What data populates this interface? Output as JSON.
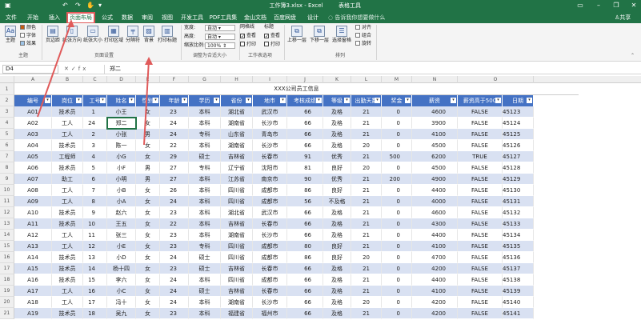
{
  "titlebar": {
    "doc_title": "工作簿3.xlsx - Excel",
    "context_title": "表格工具",
    "quick_access": [
      "save-icon",
      "undo-icon",
      "redo-icon",
      "touch-mode-icon",
      "customize-icon"
    ],
    "window_controls": [
      "ribbon-display-icon",
      "minimize-icon",
      "restore-icon",
      "close-icon"
    ]
  },
  "tabs": [
    "文件",
    "开始",
    "插入",
    "页面布局",
    "公式",
    "数据",
    "审阅",
    "视图",
    "开发工具",
    "PDF工具集",
    "金山文档",
    "百度网盘",
    "设计"
  ],
  "active_tab": "页面布局",
  "tellme": "告诉我你想要做什么",
  "share": "共享",
  "ribbon": {
    "theme_group": {
      "label": "主题",
      "main": "主题",
      "small": [
        "颜色",
        "字体",
        "效果"
      ]
    },
    "page_setup_group": {
      "label": "页面设置",
      "buttons": [
        "页边距",
        "纸张方向",
        "纸张大小",
        "打印区域",
        "分隔符",
        "背景",
        "打印标题"
      ]
    },
    "scale_group": {
      "label": "调整为合适大小",
      "rows": [
        {
          "name": "宽度:",
          "value": "自动"
        },
        {
          "name": "高度:",
          "value": "自动"
        },
        {
          "name": "缩放比例:",
          "value": "100%"
        }
      ]
    },
    "sheet_options_group": {
      "label": "工作表选项",
      "cols": [
        "网格线",
        "标题"
      ],
      "view": "查看",
      "print": "打印"
    },
    "arrange_group": {
      "label": "排列",
      "buttons": [
        "上移一层",
        "下移一层",
        "选择窗格"
      ],
      "small": [
        "对齐",
        "组合",
        "旋转"
      ]
    }
  },
  "formula_bar": {
    "name_box": "D4",
    "fx": "fx",
    "value": "郑二"
  },
  "columns": [
    "A",
    "B",
    "C",
    "D",
    "E",
    "F",
    "G",
    "H",
    "I",
    "J",
    "K",
    "L",
    "M",
    "N",
    "O"
  ],
  "table_title": "XXX公司员工信息",
  "headers": [
    "编号",
    "岗位",
    "工号",
    "姓名",
    "性别",
    "年龄",
    "学历",
    "省份",
    "地市",
    "考核成绩",
    "等级",
    "出勤天数",
    "奖金",
    "薪资",
    "薪资高于500",
    "日期"
  ],
  "rows": [
    [
      "A01",
      "技术员",
      "1",
      "小王",
      "女",
      "23",
      "本科",
      "湖北省",
      "武汉市",
      "66",
      "及格",
      "21",
      "0",
      "4600",
      "FALSE",
      "45123"
    ],
    [
      "A02",
      "工人",
      "24",
      "郑二",
      "女",
      "24",
      "本科",
      "湖南省",
      "长沙市",
      "66",
      "及格",
      "21",
      "0",
      "3900",
      "FALSE",
      "45124"
    ],
    [
      "A03",
      "工人",
      "2",
      "小张",
      "男",
      "24",
      "专科",
      "山东省",
      "青岛市",
      "66",
      "及格",
      "21",
      "0",
      "4100",
      "FALSE",
      "45125"
    ],
    [
      "A04",
      "技术员",
      "3",
      "陈一",
      "女",
      "22",
      "本科",
      "湖南省",
      "长沙市",
      "66",
      "及格",
      "20",
      "0",
      "4500",
      "FALSE",
      "45126"
    ],
    [
      "A05",
      "工程师",
      "4",
      "小G",
      "女",
      "29",
      "硕士",
      "吉林省",
      "长春市",
      "91",
      "优秀",
      "21",
      "500",
      "6200",
      "TRUE",
      "45127"
    ],
    [
      "A06",
      "技术员",
      "5",
      "小F",
      "男",
      "27",
      "专科",
      "辽宁省",
      "沈阳市",
      "81",
      "良好",
      "20",
      "0",
      "4500",
      "FALSE",
      "45128"
    ],
    [
      "A07",
      "助工",
      "6",
      "小明",
      "男",
      "27",
      "本科",
      "江苏省",
      "南京市",
      "90",
      "优秀",
      "21",
      "200",
      "4900",
      "FALSE",
      "45129"
    ],
    [
      "A08",
      "工人",
      "7",
      "小B",
      "女",
      "26",
      "本科",
      "四川省",
      "成都市",
      "86",
      "良好",
      "21",
      "0",
      "4400",
      "FALSE",
      "45130"
    ],
    [
      "A09",
      "工人",
      "8",
      "小A",
      "女",
      "24",
      "本科",
      "四川省",
      "成都市",
      "56",
      "不及格",
      "21",
      "0",
      "4000",
      "FALSE",
      "45131"
    ],
    [
      "A10",
      "技术员",
      "9",
      "赵六",
      "女",
      "23",
      "本科",
      "湖北省",
      "武汉市",
      "66",
      "及格",
      "21",
      "0",
      "4600",
      "FALSE",
      "45132"
    ],
    [
      "A11",
      "技术员",
      "10",
      "王五",
      "女",
      "22",
      "本科",
      "吉林省",
      "长春市",
      "66",
      "及格",
      "21",
      "0",
      "4300",
      "FALSE",
      "45133"
    ],
    [
      "A12",
      "工人",
      "11",
      "张三",
      "女",
      "23",
      "本科",
      "湖南省",
      "长沙市",
      "66",
      "及格",
      "21",
      "0",
      "4400",
      "FALSE",
      "45134"
    ],
    [
      "A13",
      "工人",
      "12",
      "小E",
      "女",
      "23",
      "专科",
      "四川省",
      "成都市",
      "80",
      "良好",
      "21",
      "0",
      "4100",
      "FALSE",
      "45135"
    ],
    [
      "A14",
      "技术员",
      "13",
      "小D",
      "女",
      "24",
      "硕士",
      "四川省",
      "成都市",
      "86",
      "良好",
      "20",
      "0",
      "4700",
      "FALSE",
      "45136"
    ],
    [
      "A15",
      "技术员",
      "14",
      "杨十四",
      "女",
      "23",
      "硕士",
      "吉林省",
      "长春市",
      "66",
      "及格",
      "21",
      "0",
      "4200",
      "FALSE",
      "45137"
    ],
    [
      "A16",
      "技术员",
      "15",
      "李六",
      "女",
      "24",
      "本科",
      "四川省",
      "成都市",
      "66",
      "及格",
      "21",
      "0",
      "4400",
      "FALSE",
      "45138"
    ],
    [
      "A17",
      "工人",
      "16",
      "小C",
      "女",
      "24",
      "硕士",
      "吉林省",
      "长春市",
      "66",
      "及格",
      "21",
      "0",
      "4100",
      "FALSE",
      "45139"
    ],
    [
      "A18",
      "工人",
      "17",
      "冯十",
      "女",
      "24",
      "本科",
      "湖南省",
      "长沙市",
      "66",
      "及格",
      "20",
      "0",
      "4200",
      "FALSE",
      "45140"
    ],
    [
      "A19",
      "技术员",
      "18",
      "吴九",
      "女",
      "23",
      "本科",
      "福建省",
      "福州市",
      "66",
      "及格",
      "21",
      "0",
      "4200",
      "FALSE",
      "45141"
    ]
  ],
  "row_numbers": [
    "1",
    "2",
    "3",
    "4",
    "5",
    "6",
    "7",
    "8",
    "9",
    "10",
    "11",
    "12",
    "13",
    "14",
    "15",
    "16",
    "17",
    "18",
    "19",
    "20",
    "21"
  ],
  "selected_cell": {
    "row": "4",
    "col": "D"
  },
  "colors": {
    "accent": "#217346",
    "header_fill": "#4472c4",
    "band_fill": "#d9e1f2",
    "annotation": "#e05a5a"
  }
}
